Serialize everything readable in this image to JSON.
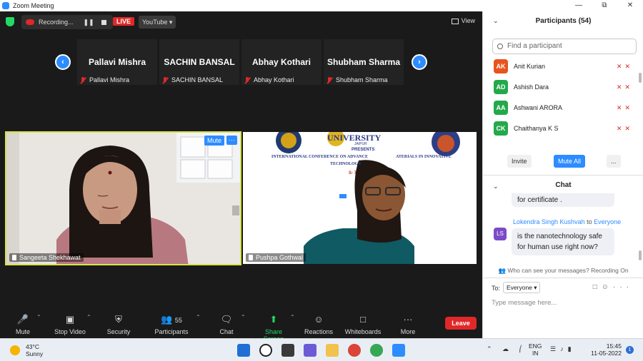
{
  "window": {
    "title": "Zoom Meeting"
  },
  "top_bar": {
    "recording_label": "Recording...",
    "live_badge": "LIVE",
    "stream_target": "YouTube",
    "view_label": "View"
  },
  "thumbnails": [
    {
      "name": "Pallavi Mishra",
      "label": "Pallavi Mishra"
    },
    {
      "name": "SACHIN BANSAL",
      "label": "SACHIN BANSAL"
    },
    {
      "name": "Abhay Kothari",
      "label": "Abhay Kothari"
    },
    {
      "name": "Shubham Sharma",
      "label": "Shubham Sharma"
    }
  ],
  "videos": [
    {
      "name": "Sangeeta Shekhawat",
      "mute_label": "Mute",
      "more_label": "···"
    },
    {
      "name": "Pushpa Gothwal"
    }
  ],
  "slide": {
    "university": "UNIVERSITY",
    "city": "JAIPUR",
    "presents": "PRESENTS",
    "line1": "INTERNATIONAL CONFERENCE ON ADVANCE",
    "line1b": "ATERIALS IN INNOVATIVE",
    "line2": "TECHNOLOGY",
    "date_fragment": "S- 7"
  },
  "toolbar": {
    "mute": "Mute",
    "stop_video": "Stop Video",
    "security": "Security",
    "participants": "Participants",
    "participants_count": "55",
    "chat": "Chat",
    "share_screen": "Share Screen",
    "reactions": "Reactions",
    "whiteboards": "Whiteboards",
    "more": "More",
    "leave": "Leave"
  },
  "participants_panel": {
    "title": "Participants (54)",
    "search_placeholder": "Find a participant",
    "people": [
      {
        "initials": "AK",
        "name": "Anit Kurian",
        "color": "#e8541c"
      },
      {
        "initials": "AD",
        "name": "Ashish Dara",
        "color": "#23a94a"
      },
      {
        "initials": "AA",
        "name": "Ashwani ARORA",
        "color": "#23a94a"
      },
      {
        "initials": "CK",
        "name": "Chaithanya K S",
        "color": "#23a94a"
      }
    ],
    "invite": "Invite",
    "mute_all": "Mute All",
    "more": "..."
  },
  "chat_panel": {
    "title": "Chat",
    "prev_message": "for certificate .",
    "sender": "Lokendra Singh Kushvah",
    "to_text": "to",
    "recipient": "Everyone",
    "sender_initials": "LS",
    "message_line1": "is the nanotechnology safe",
    "message_line2": "for human use right now?",
    "who_can_see": "Who can see your messages? Recording On",
    "to_label": "To:",
    "to_value": "Everyone",
    "input_placeholder": "Type message here..."
  },
  "taskbar": {
    "temperature": "43°C",
    "weather": "Sunny",
    "lang1": "ENG",
    "lang2": "IN",
    "time": "15:45",
    "date": "11-05-2022",
    "notifications": "1"
  }
}
